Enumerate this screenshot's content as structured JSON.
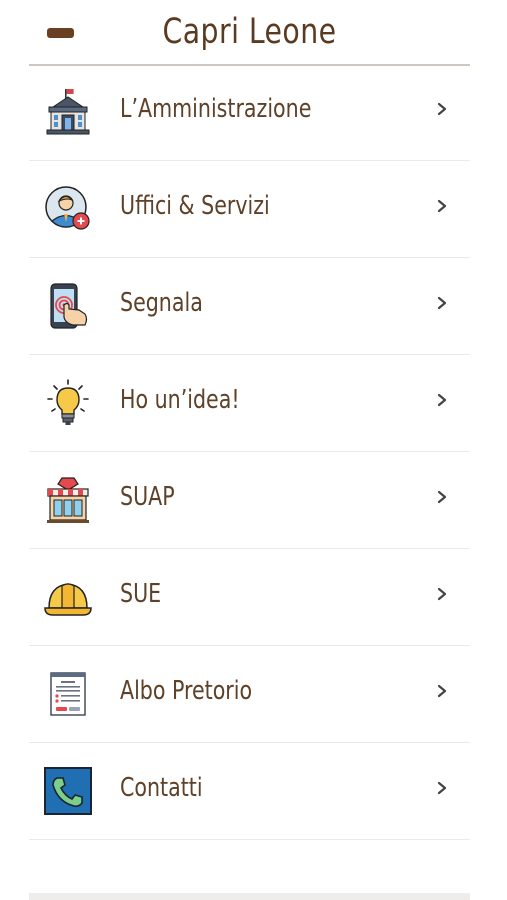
{
  "header": {
    "title": "Capri Leone",
    "back_icon": "back-arrow-icon"
  },
  "menu": {
    "items": [
      {
        "label": "L’Amministrazione",
        "icon": "town-hall-icon"
      },
      {
        "label": "Uffici & Servizi",
        "icon": "office-staff-icon"
      },
      {
        "label": "Segnala",
        "icon": "phone-tap-icon"
      },
      {
        "label": "Ho un’idea!",
        "icon": "lightbulb-icon"
      },
      {
        "label": "SUAP",
        "icon": "shop-icon"
      },
      {
        "label": "SUE",
        "icon": "hard-hat-icon"
      },
      {
        "label": "Albo Pretorio",
        "icon": "document-list-icon"
      },
      {
        "label": "Contatti",
        "icon": "telephone-icon"
      }
    ]
  },
  "colors": {
    "text": "#5e4128",
    "divider": "#eceae7",
    "header_rule": "#cfc6bd"
  }
}
